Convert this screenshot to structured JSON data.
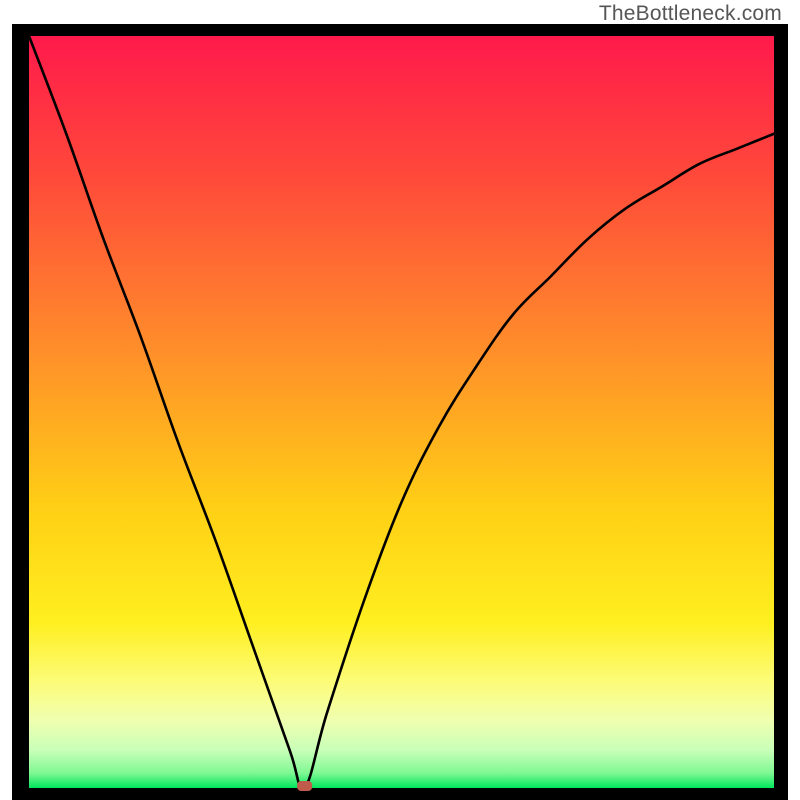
{
  "watermark": "TheBottleneck.com",
  "chart_data": {
    "type": "line",
    "title": "",
    "xlabel": "",
    "ylabel": "",
    "xlim": [
      0,
      100
    ],
    "ylim": [
      0,
      100
    ],
    "background_gradient": {
      "top_color": "#ff1a4b",
      "mid_color": "#ffe100",
      "bottom_color": "#00e65c",
      "description": "vertical heat gradient red->orange->yellow->green inside black square frame"
    },
    "minimum_marker": {
      "x": 37,
      "y": 0,
      "color": "#c05a4b"
    },
    "series": [
      {
        "name": "bottleneck-curve",
        "x": [
          0,
          5,
          10,
          15,
          20,
          25,
          30,
          35,
          37,
          40,
          45,
          50,
          55,
          60,
          65,
          70,
          75,
          80,
          85,
          90,
          95,
          100
        ],
        "values": [
          100,
          87,
          73,
          60,
          46,
          33,
          19,
          5,
          0,
          10,
          25,
          38,
          48,
          56,
          63,
          68,
          73,
          77,
          80,
          83,
          85,
          87
        ]
      }
    ]
  }
}
